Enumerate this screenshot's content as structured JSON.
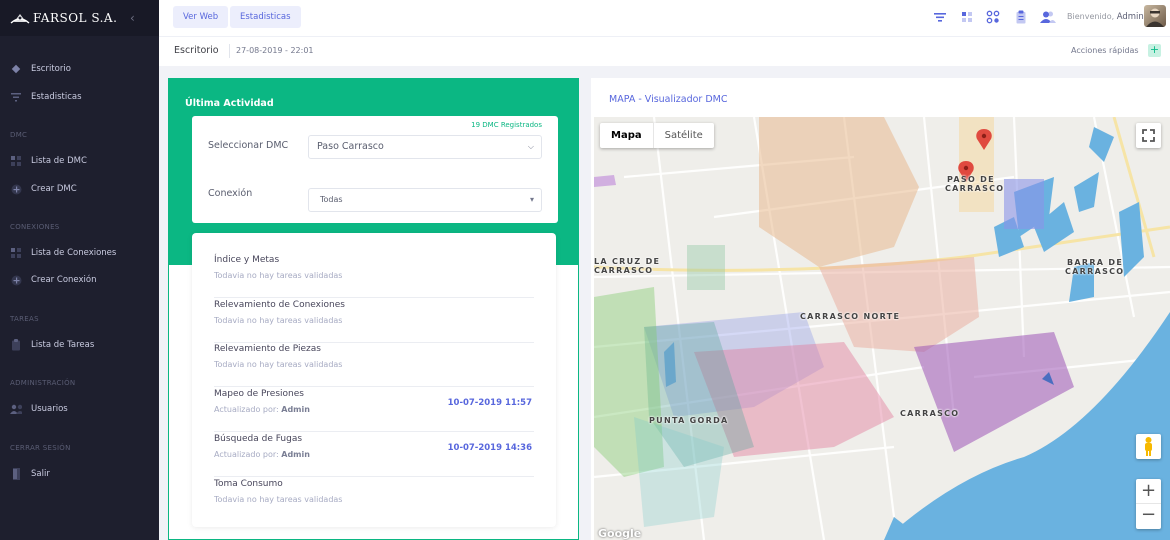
{
  "brand": {
    "name": "FARSOL S.A.",
    "collapse_icon": "chevron-left-icon"
  },
  "sidebar": {
    "items": [
      {
        "label": "Escritorio",
        "icon": "diamond-icon"
      },
      {
        "label": "Estadisticas",
        "icon": "filter-icon"
      }
    ],
    "sections": [
      {
        "title": "DMC",
        "items": [
          {
            "label": "Lista de DMC",
            "icon": "grid-icon"
          },
          {
            "label": "Crear DMC",
            "icon": "plus-circle-icon"
          }
        ]
      },
      {
        "title": "CONEXIONES",
        "items": [
          {
            "label": "Lista de Conexiones",
            "icon": "grid-icon"
          },
          {
            "label": "Crear Conexión",
            "icon": "plus-circle-icon"
          }
        ]
      },
      {
        "title": "TAREAS",
        "items": [
          {
            "label": "Lista de Tareas",
            "icon": "clipboard-icon"
          }
        ]
      },
      {
        "title": "ADMINISTRACIÓN",
        "items": [
          {
            "label": "Usuarios",
            "icon": "users-icon"
          }
        ]
      },
      {
        "title": "CERRAR SESIÓN",
        "items": [
          {
            "label": "Salir",
            "icon": "door-icon"
          }
        ]
      }
    ]
  },
  "topbar": {
    "buttons": [
      "Ver Web",
      "Estadisticas"
    ],
    "welcome": "Bienvenido,",
    "user": "Admin",
    "icons": [
      "filter-icon",
      "grid-icon",
      "nodes-icon",
      "clipboard-icon",
      "users-icon"
    ],
    "accent": "#5867dd"
  },
  "subheader": {
    "title": "Escritorio",
    "datetime": "27-08-2019 - 22:01",
    "quick_actions": "Acciones rápidas",
    "plus": "+"
  },
  "activity": {
    "title": "Última Actividad",
    "dmc_count": "19 DMC Registrados",
    "dmc_label": "Seleccionar DMC",
    "dmc_value": "Paso Carrasco",
    "connection_label": "Conexión",
    "connection_value": "Todas",
    "accent": "#0bb783",
    "tasks": [
      {
        "name": "Índice y Metas",
        "status": "Todavia no hay tareas validadas",
        "by": "",
        "date": ""
      },
      {
        "name": "Relevamiento de Conexiones",
        "status": "Todavia no hay tareas validadas",
        "by": "",
        "date": ""
      },
      {
        "name": "Relevamiento de Piezas",
        "status": "Todavia no hay tareas validadas",
        "by": "",
        "date": ""
      },
      {
        "name": "Mapeo de Presiones",
        "status": "Actualizado por:",
        "by": "Admin",
        "date": "10-07-2019 11:57"
      },
      {
        "name": "Búsqueda de Fugas",
        "status": "Actualizado por:",
        "by": "Admin",
        "date": "10-07-2019 14:36"
      },
      {
        "name": "Toma Consumo",
        "status": "Todavia no hay tareas validadas",
        "by": "",
        "date": ""
      }
    ]
  },
  "map": {
    "title": "MAPA - Visualizador DMC",
    "type_map": "Mapa",
    "type_satellite": "Satélite",
    "zoom_in": "+",
    "zoom_out": "−",
    "places": [
      "PASO DE",
      "CARRASCO",
      "LA CRUZ DE",
      "CARRASCO",
      "BARRA DE",
      "CARRASCO",
      "CARRASCO NORTE",
      "PUNTA GORDA",
      "CARRASCO"
    ],
    "attribution": "Google",
    "colors": {
      "water": "#6ab2e0",
      "marker": "#e04a3f"
    }
  }
}
